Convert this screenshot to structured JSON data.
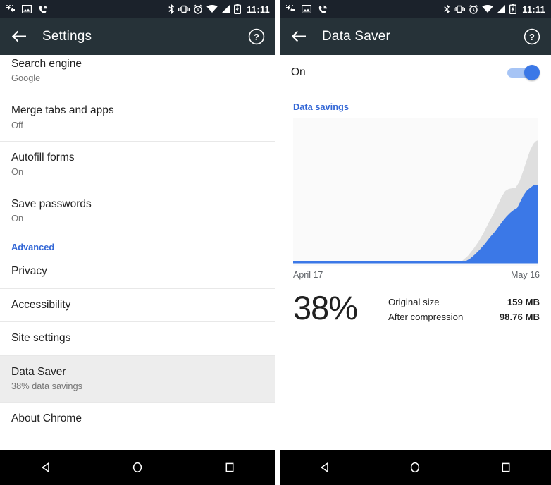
{
  "status_bar": {
    "left_icons": [
      "data-transfer-icon",
      "image-icon",
      "phone-call-icon"
    ],
    "right_icons": [
      "bluetooth-icon",
      "vibrate-icon",
      "alarm-icon",
      "wifi-icon",
      "signal-icon",
      "battery-charging-icon"
    ],
    "time": "11:11"
  },
  "left_screen": {
    "appbar": {
      "back_icon": "arrow-back-icon",
      "title": "Settings",
      "help_icon": "help-circle-icon"
    },
    "rows": [
      {
        "title": "Search engine",
        "sub": "Google",
        "selected": false
      },
      {
        "title": "Merge tabs and apps",
        "sub": "Off",
        "selected": false
      },
      {
        "title": "Autofill forms",
        "sub": "On",
        "selected": false
      },
      {
        "title": "Save passwords",
        "sub": "On",
        "selected": false
      }
    ],
    "section_header": "Advanced",
    "advanced_rows": [
      {
        "title": "Privacy",
        "sub": "",
        "selected": false
      },
      {
        "title": "Accessibility",
        "sub": "",
        "selected": false
      },
      {
        "title": "Site settings",
        "sub": "",
        "selected": false
      },
      {
        "title": "Data Saver",
        "sub": "38% data savings",
        "selected": true
      },
      {
        "title": "About Chrome",
        "sub": "",
        "selected": false
      }
    ]
  },
  "right_screen": {
    "appbar": {
      "back_icon": "arrow-back-icon",
      "title": "Data Saver",
      "help_icon": "help-circle-icon"
    },
    "toggle": {
      "label": "On",
      "state": "on",
      "accent": "#3b78e7"
    },
    "savings_header": "Data savings",
    "axis": {
      "start": "April 17",
      "end": "May 16"
    },
    "percent": "38%",
    "stats": [
      {
        "label": "Original size",
        "value": "159 MB"
      },
      {
        "label": "After compression",
        "value": "98.76 MB"
      }
    ]
  },
  "nav_bar": {
    "back": "nav-back-icon",
    "home": "nav-home-icon",
    "recents": "nav-recents-icon"
  },
  "chart_data": {
    "type": "area",
    "title": "Data savings",
    "xlabel": "",
    "ylabel": "",
    "stacked": true,
    "grid": false,
    "legend": "none",
    "x": [
      "April 17",
      "April 18",
      "April 19",
      "April 20",
      "April 21",
      "April 22",
      "April 23",
      "April 24",
      "April 25",
      "April 26",
      "April 27",
      "April 28",
      "April 29",
      "April 30",
      "May 1",
      "May 2",
      "May 3",
      "May 4",
      "May 5",
      "May 6",
      "May 7",
      "May 8",
      "May 9",
      "May 10",
      "May 11",
      "May 12",
      "May 13",
      "May 14",
      "May 15",
      "May 16"
    ],
    "axis_start_label": "April 17",
    "axis_end_label": "May 16",
    "series": [
      {
        "name": "After compression",
        "color": "#3b78e7",
        "values": [
          0,
          0,
          0,
          0,
          0,
          0,
          0,
          0,
          0,
          0,
          0,
          0,
          0,
          0,
          0,
          0,
          0,
          0,
          0,
          0,
          1,
          4,
          11,
          20,
          29,
          37,
          42,
          56,
          76,
          98.76
        ]
      },
      {
        "name": "Savings",
        "color": "#dddddd",
        "values": [
          0,
          0,
          0,
          0,
          0,
          0,
          0,
          0,
          0,
          0,
          0,
          0,
          0,
          0,
          0,
          0,
          0,
          0,
          0,
          0,
          1,
          5,
          13,
          24,
          37,
          44,
          49,
          68,
          84,
          60.24
        ]
      }
    ],
    "total_original_size_mb": 159,
    "total_after_compression_mb": 98.76,
    "savings_percent": 38,
    "ylim": [
      0,
      175
    ],
    "plot_bg": "#fafafa",
    "baseline_color": "#3b78e7"
  }
}
